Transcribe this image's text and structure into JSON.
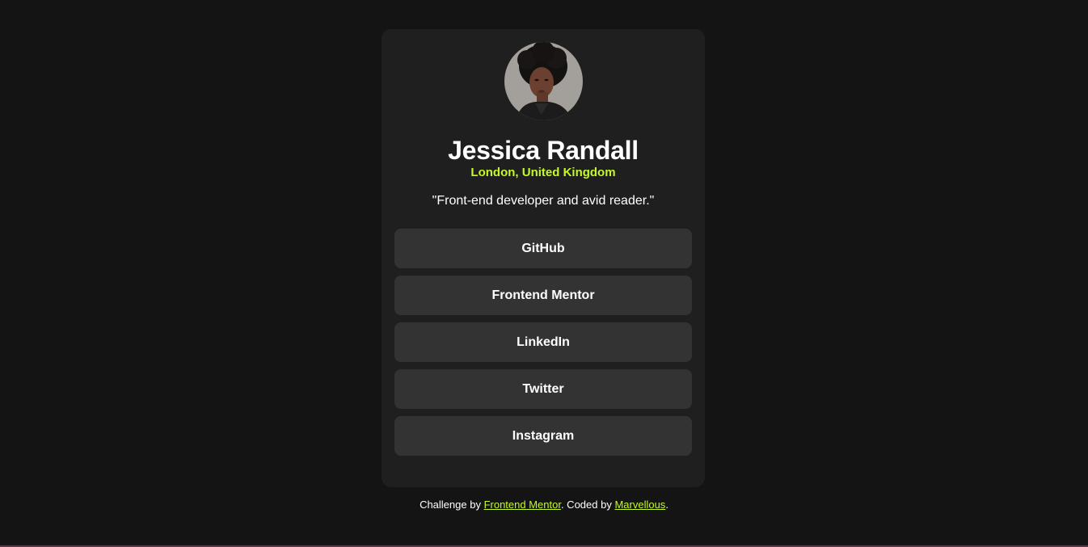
{
  "profile": {
    "name": "Jessica Randall",
    "location": "London, United Kingdom",
    "bio": "\"Front-end developer and avid reader.\""
  },
  "links": [
    {
      "label": "GitHub"
    },
    {
      "label": "Frontend Mentor"
    },
    {
      "label": "LinkedIn"
    },
    {
      "label": "Twitter"
    },
    {
      "label": "Instagram"
    }
  ],
  "footer": {
    "prefix": "Challenge by ",
    "challenge_link": "Frontend Mentor",
    "middle": ". Coded by ",
    "author_link": "Marvellous",
    "suffix": "."
  },
  "colors": {
    "background": "#141414",
    "card": "#1f1f1f",
    "button": "#333333",
    "accent": "#c4f82a",
    "text": "#ffffff"
  }
}
